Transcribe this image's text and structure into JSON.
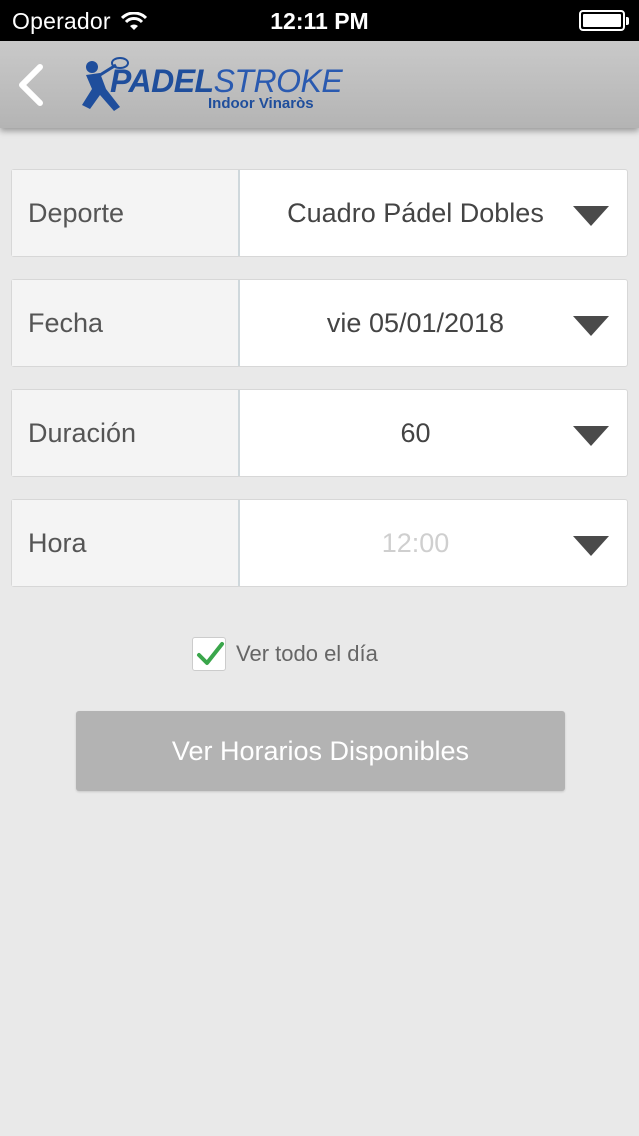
{
  "status_bar": {
    "carrier": "Operador",
    "time": "12:11 PM"
  },
  "header": {
    "logo": {
      "brand_bold": "PADEL",
      "brand_thin": "STROKE",
      "tagline": "Indoor Vinaròs",
      "brand_color": "#1f4e9c"
    }
  },
  "form": {
    "rows": [
      {
        "label": "Deporte",
        "value": "Cuadro Pádel Dobles"
      },
      {
        "label": "Fecha",
        "value": "vie 05/01/2018"
      },
      {
        "label": "Duración",
        "value": "60"
      },
      {
        "label": "Hora",
        "value": "12:00"
      }
    ],
    "all_day": {
      "label": "Ver todo el día",
      "checked": true
    },
    "submit_label": "Ver Horarios Disponibles"
  },
  "colors": {
    "background": "#e9e9e9",
    "check_green": "#3aa64b",
    "button_disabled": "#b3b3b3"
  }
}
